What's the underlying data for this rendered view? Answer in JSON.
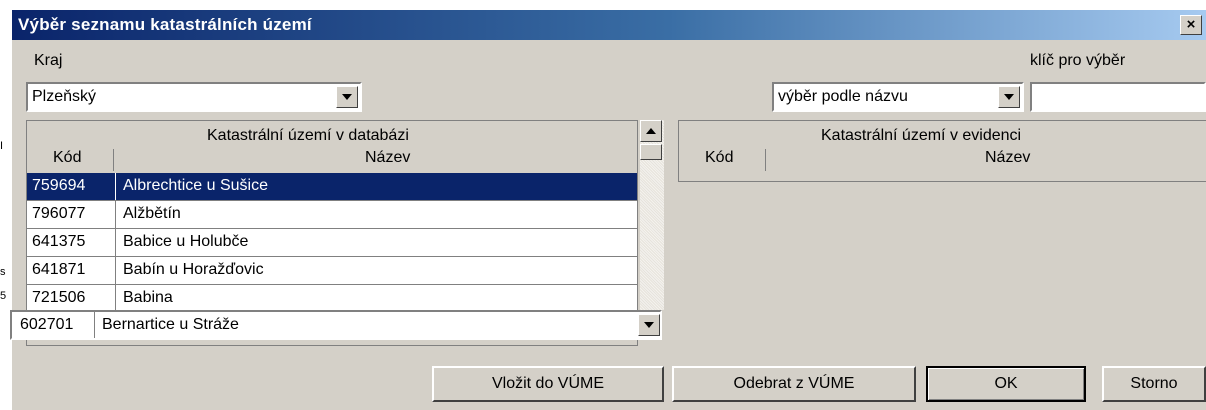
{
  "dialog": {
    "title": "Výběr seznamu katastrálních území",
    "close": "×"
  },
  "kraj": {
    "label": "Kraj",
    "value": "Plzeňský"
  },
  "filter": {
    "label": "klíč pro výběr",
    "mode": "výběr podle názvu",
    "key_value": ""
  },
  "left_grid": {
    "caption": "Katastrální území v databázi",
    "col_code": "Kód",
    "col_name": "Název",
    "rows": [
      {
        "code": "759694",
        "name": "Albrechtice u Sušice",
        "selected": true
      },
      {
        "code": "796077",
        "name": "Alžbětín",
        "selected": false
      },
      {
        "code": "641375",
        "name": "Babice u Holubče",
        "selected": false
      },
      {
        "code": "641871",
        "name": "Babín u Horažďovic",
        "selected": false
      },
      {
        "code": "721506",
        "name": "Babina",
        "selected": false
      }
    ],
    "editor": {
      "code": "602701",
      "name": "Bernartice u Stráže"
    }
  },
  "right_grid": {
    "caption": "Katastrální území v evidenci",
    "col_code": "Kód",
    "col_name": "Název"
  },
  "buttons": {
    "insert": "Vložit do VÚME",
    "remove": "Odebrat z VÚME",
    "ok": "OK",
    "cancel": "Storno"
  },
  "background_marks": [
    "I",
    "s",
    "5"
  ]
}
